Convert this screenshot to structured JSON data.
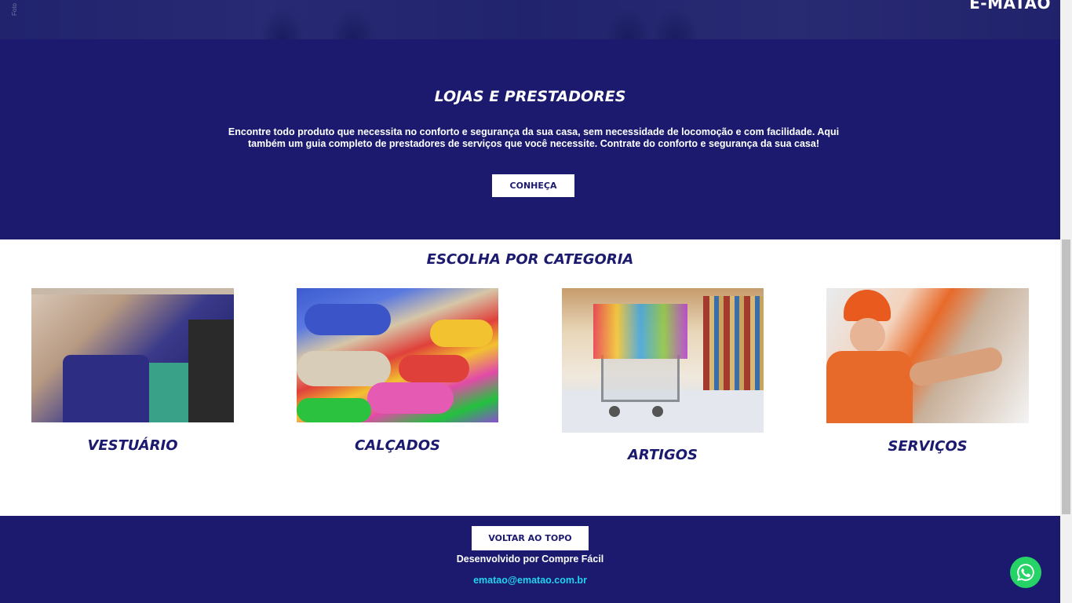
{
  "hero": {
    "brand": "E-MATAO",
    "photo_credit": "Foto"
  },
  "intro": {
    "title": "LOJAS E PRESTADORES",
    "description": "Encontre todo produto que necessita no conforto e segurança da sua casa, sem necessidade de locomoção e com facilidade. Aqui também um guia completo de prestadores de serviços que você necessite. Contrate do conforto e segurança da sua casa!",
    "button_label": "CONHEÇA"
  },
  "categories": {
    "title": "ESCOLHA POR CATEGORIA",
    "items": [
      {
        "label": "VESTUÁRIO"
      },
      {
        "label": "CALÇADOS"
      },
      {
        "label": "ARTIGOS"
      },
      {
        "label": "SERVIÇOS"
      }
    ]
  },
  "footer": {
    "back_to_top_label": "VOLTAR AO TOPO",
    "developed_by": "Desenvolvido por Compre Fácil",
    "email": "ematao@ematao.com.br"
  },
  "colors": {
    "brand_navy": "#1b1a6f",
    "email_cyan": "#22d3f0",
    "whatsapp_green": "#25d366"
  }
}
